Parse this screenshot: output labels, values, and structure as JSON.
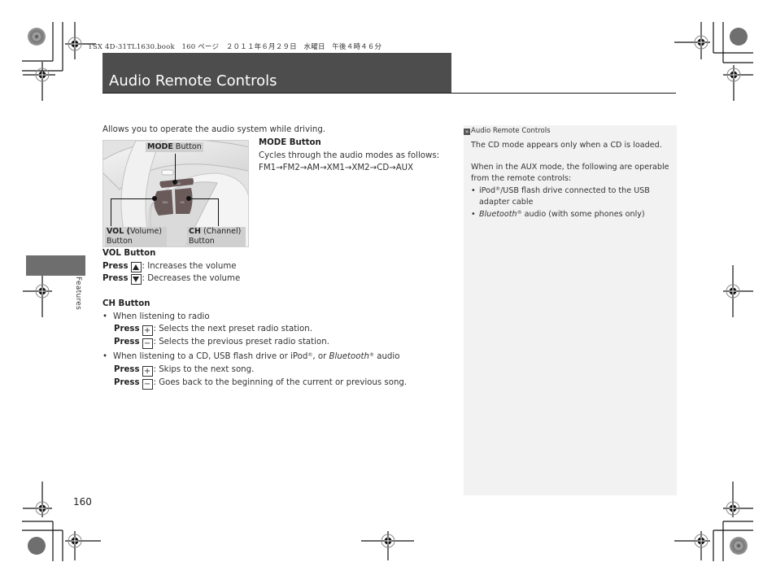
{
  "print_header": "TSX 4D-31TL1630.book　160 ページ　２０１１年６月２９日　水曜日　午後４時４６分",
  "header": {
    "title": "Audio Remote Controls"
  },
  "side_tab": {
    "label": "Features"
  },
  "intro": "Allows you to operate the audio system while driving.",
  "illustration": {
    "mode_label_bold": "MODE",
    "mode_label_rest": " Button",
    "vol_label_bold": "VOL (",
    "vol_label_rest": "Volume)",
    "vol_label_line2": "Button",
    "ch_label_bold": "CH",
    "ch_label_rest": " (Channel)",
    "ch_label_line2": "Button",
    "btn_mode": "MODE",
    "btn_vol": "VOL",
    "btn_ch": "CH"
  },
  "mode_section": {
    "heading": "MODE Button",
    "description": "Cycles through the audio modes as follows:",
    "sequence": "FM1→FM2→AM→XM1→XM2→CD→AUX"
  },
  "vol_section": {
    "heading": "VOL Button",
    "items": [
      {
        "press": "Press",
        "key": "up-triangle",
        "text": ": Increases the volume"
      },
      {
        "press": "Press",
        "key": "down-triangle",
        "text": ": Decreases the volume"
      }
    ]
  },
  "ch_section": {
    "heading": "CH Button",
    "bullet1": "When listening to radio",
    "radio_items": [
      {
        "press": "Press",
        "key": "+",
        "text": ": Selects the next preset radio station."
      },
      {
        "press": "Press",
        "key": "−",
        "text": ": Selects the previous preset radio station."
      }
    ],
    "bullet2_pre": "When listening to a CD, USB flash drive or iPod",
    "bullet2_reg": "®",
    "bullet2_mid": ", or ",
    "bullet2_italic": "Bluetooth",
    "bullet2_reg2": "®",
    "bullet2_post": " audio",
    "media_items": [
      {
        "press": "Press",
        "key": "+",
        "text": ": Skips to the next song."
      },
      {
        "press": "Press",
        "key": "−",
        "text": ": Goes back to the beginning of the current or previous song."
      }
    ]
  },
  "note": {
    "icon": "double-chevron-icon",
    "title": "Audio Remote Controls",
    "para1": "The CD mode appears only when a CD is loaded.",
    "para2_line1": "When in the AUX mode, the following are operable",
    "para2_line2": "from the remote controls:",
    "bullet1_pre": "iPod",
    "bullet1_reg": "®",
    "bullet1_post": "/USB flash drive connected to the USB",
    "bullet1_line2": "adapter cable",
    "bullet2_italic": "Bluetooth",
    "bullet2_reg": "®",
    "bullet2_post": " audio (with some phones only)"
  },
  "page_number": "160"
}
